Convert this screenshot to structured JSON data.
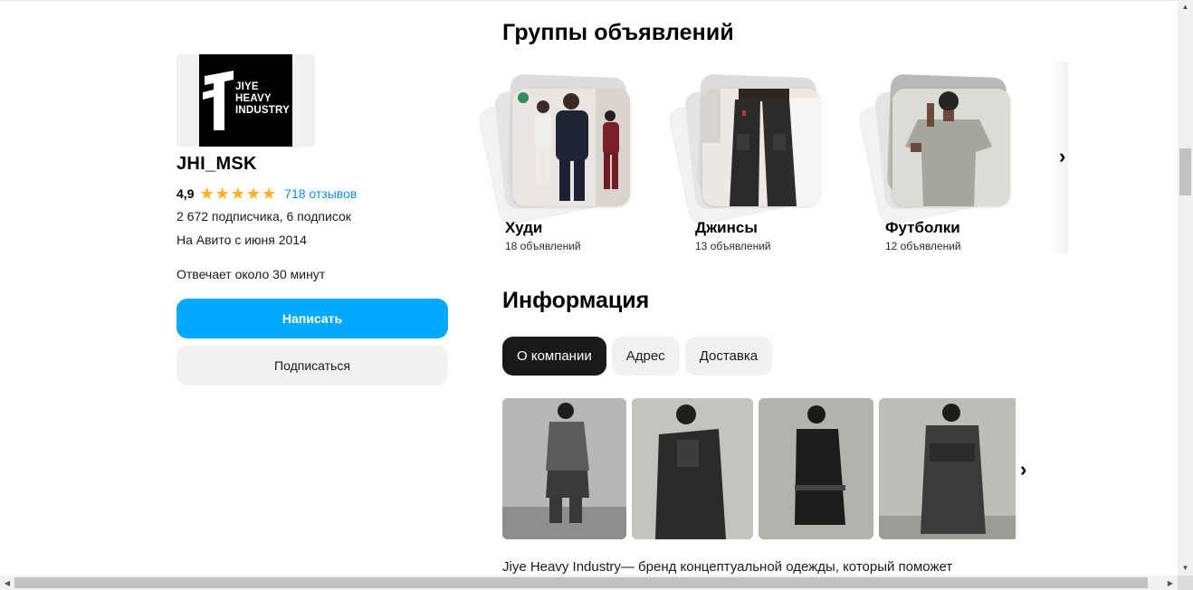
{
  "profile": {
    "logo_lines": [
      "JIYE",
      "HEAVY",
      "INDUSTRY"
    ],
    "name": "JHI_MSK",
    "rating": "4,9",
    "stars": 5,
    "reviews_link": "718 отзывов",
    "subscribers": "2 672 подписчика, 6 подписок",
    "since": "На Авито с июня 2014",
    "reply_time": "Отвечает около 30 минут",
    "write_button": "Написать",
    "subscribe_button": "Подписаться"
  },
  "groups": {
    "heading": "Группы объявлений",
    "items": [
      {
        "title": "Худи",
        "count": "18 объявлений"
      },
      {
        "title": "Джинсы",
        "count": "13 объявлений"
      },
      {
        "title": "Футболки",
        "count": "12 объявлений"
      }
    ],
    "next_icon": "chevron-right-icon"
  },
  "info": {
    "heading": "Информация",
    "tabs": [
      {
        "label": "О компании",
        "active": true
      },
      {
        "label": "Адрес",
        "active": false
      },
      {
        "label": "Доставка",
        "active": false
      }
    ],
    "description": "Jiye Heavy Industry— бренд концептуальной одежды, который поможет"
  },
  "colors": {
    "accent": "#00aaff",
    "star": "#ffb021",
    "link": "#0a8ee8",
    "tab_active": "#1a1a1a"
  }
}
